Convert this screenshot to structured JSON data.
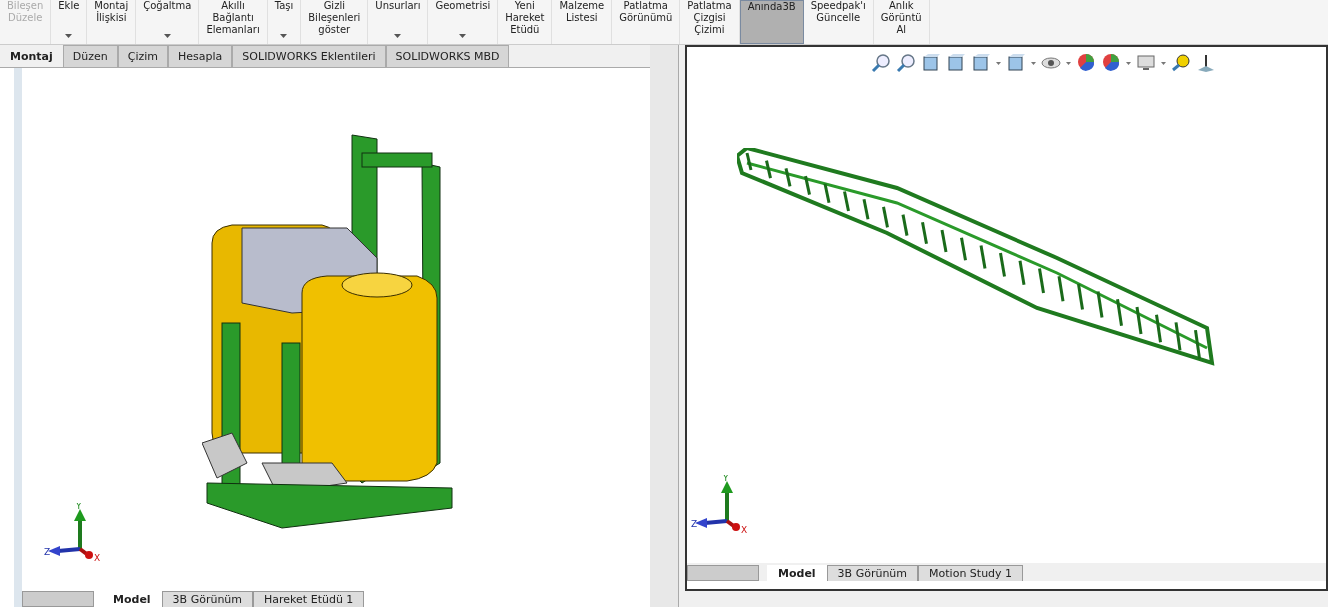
{
  "ribbon": {
    "buttons": [
      {
        "lines": [
          "Bileşen",
          "Düzele"
        ],
        "disabled": true,
        "selected": false,
        "dropdown": false
      },
      {
        "lines": [
          "Ekle"
        ],
        "disabled": false,
        "selected": false,
        "dropdown": true
      },
      {
        "lines": [
          "Montaj",
          "İlişkisi"
        ],
        "disabled": false,
        "selected": false,
        "dropdown": false
      },
      {
        "lines": [
          "Çoğaltma"
        ],
        "disabled": false,
        "selected": false,
        "dropdown": true
      },
      {
        "lines": [
          "Akıllı",
          "Bağlantı",
          "Elemanları"
        ],
        "disabled": false,
        "selected": false,
        "dropdown": false
      },
      {
        "lines": [
          "Taşı"
        ],
        "disabled": false,
        "selected": false,
        "dropdown": true
      },
      {
        "lines": [
          "Gizli",
          "Bileşenleri",
          "göster"
        ],
        "disabled": false,
        "selected": false,
        "dropdown": false
      },
      {
        "lines": [
          "Unsurları"
        ],
        "disabled": false,
        "selected": false,
        "dropdown": true
      },
      {
        "lines": [
          "Geometrisi"
        ],
        "disabled": false,
        "selected": false,
        "dropdown": true
      },
      {
        "lines": [
          "Yeni",
          "Hareket",
          "Etüdü"
        ],
        "disabled": false,
        "selected": false,
        "dropdown": false
      },
      {
        "lines": [
          "Malzeme",
          "Listesi"
        ],
        "disabled": false,
        "selected": false,
        "dropdown": false
      },
      {
        "lines": [
          "Patlatma",
          "Görünümü"
        ],
        "disabled": false,
        "selected": false,
        "dropdown": false
      },
      {
        "lines": [
          "Patlatma",
          "Çizgisi",
          "Çizimi"
        ],
        "disabled": false,
        "selected": false,
        "dropdown": false
      },
      {
        "lines": [
          "Anında3B"
        ],
        "disabled": false,
        "selected": true,
        "dropdown": false
      },
      {
        "lines": [
          "Speedpak'ı",
          "Güncelle"
        ],
        "disabled": false,
        "selected": false,
        "dropdown": false
      },
      {
        "lines": [
          "Anlık",
          "Görüntü",
          "Al"
        ],
        "disabled": false,
        "selected": false,
        "dropdown": false
      }
    ]
  },
  "command_tabs": [
    {
      "label": "Montaj",
      "selected": true
    },
    {
      "label": "Düzen",
      "selected": false
    },
    {
      "label": "Çizim",
      "selected": false
    },
    {
      "label": "Hesapla",
      "selected": false
    },
    {
      "label": "SOLIDWORKS Eklentileri",
      "selected": false
    },
    {
      "label": "SOLIDWORKS MBD",
      "selected": false
    }
  ],
  "left_view": {
    "axes": {
      "x": "X",
      "y": "Y",
      "z": "Z"
    },
    "tabs": [
      {
        "label": "Model",
        "selected": true
      },
      {
        "label": "3B Görünüm",
        "selected": false
      },
      {
        "label": "Hareket Etüdü 1",
        "selected": false
      }
    ]
  },
  "right_view": {
    "axes": {
      "x": "X",
      "y": "Y",
      "z": "Z"
    },
    "tabs": [
      {
        "label": "Model",
        "selected": true
      },
      {
        "label": "3B Görünüm",
        "selected": false
      },
      {
        "label": "Motion Study 1",
        "selected": false
      }
    ]
  }
}
